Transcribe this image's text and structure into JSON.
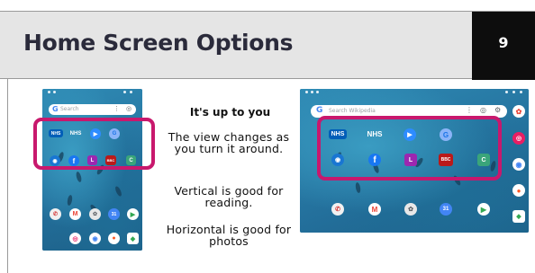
{
  "slide": {
    "title": "Home Screen Options",
    "page_number": "9",
    "subtitle": "It's up to you",
    "paragraphs": [
      "The view changes as you turn it around.",
      "Vertical is good for reading.",
      "Horizontal is good for photos"
    ]
  },
  "portrait_phone": {
    "search_logo": "G",
    "search_placeholder": "Search",
    "apps_row1": [
      "NHS",
      "NHS",
      "Zoom",
      "Google"
    ],
    "apps_row2": [
      "Camera",
      "Facebook",
      "L",
      "BBC",
      "C"
    ]
  },
  "landscape_phone": {
    "search_logo": "G",
    "search_placeholder": "Search Wikipedia",
    "nhs_labels": [
      "NHS",
      "NHS"
    ],
    "bbc_label": "BBC",
    "l_label": "L",
    "c_label": "C"
  },
  "colors": {
    "highlight": "#c8186d",
    "header_bg": "#e5e5e5",
    "page_num_bg": "#0d0d0d",
    "water": "#2a7ea6"
  }
}
